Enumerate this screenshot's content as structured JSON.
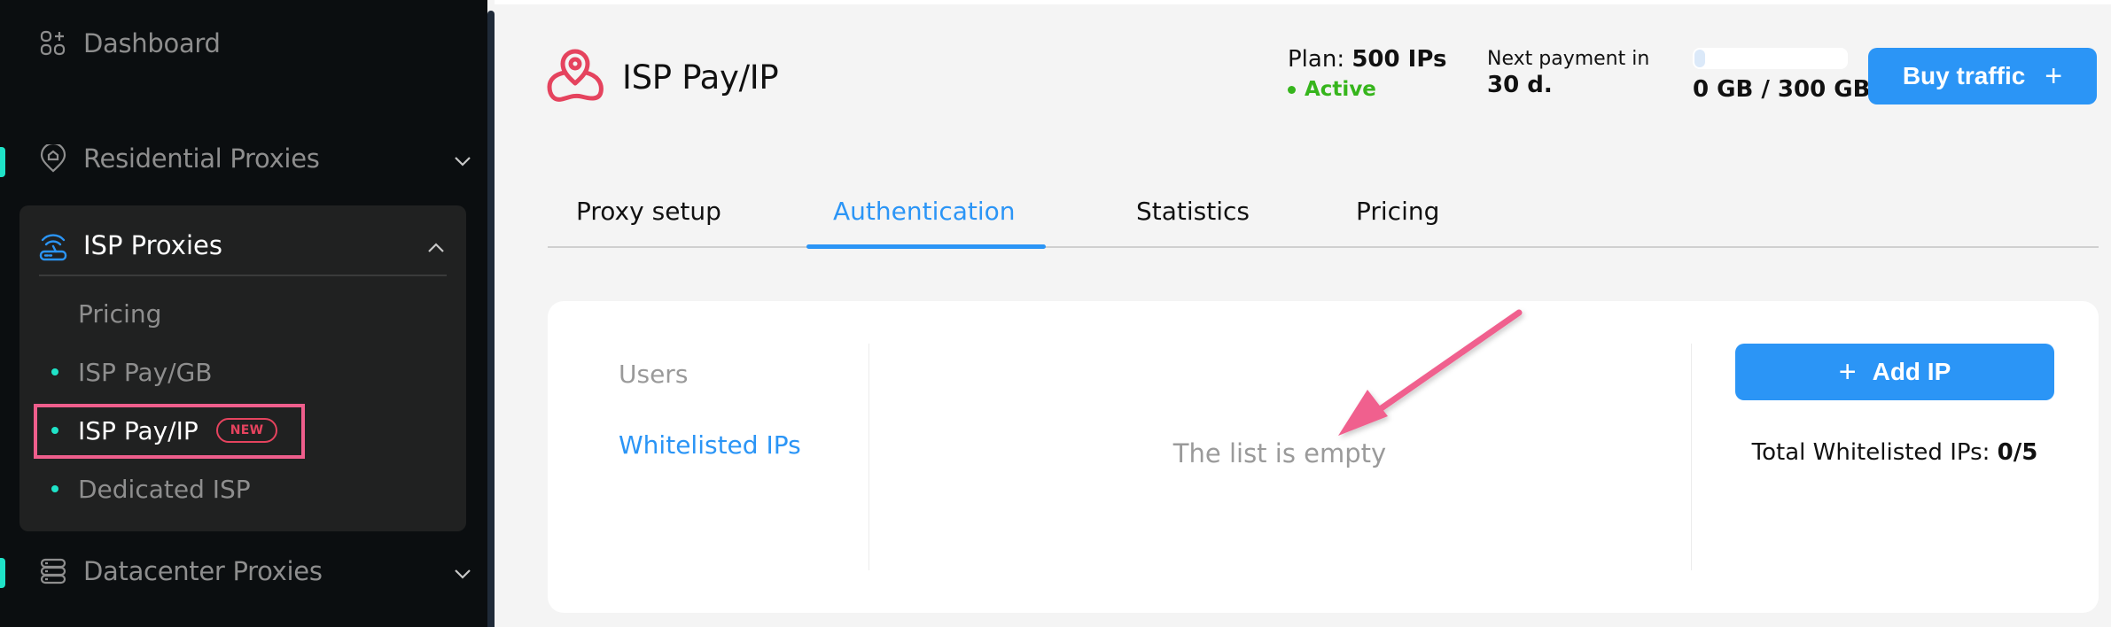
{
  "sidebar": {
    "items": [
      {
        "label": "Dashboard",
        "icon": "dashboard-grid-icon"
      },
      {
        "label": "Residential Proxies",
        "icon": "location-home-icon",
        "expanded": false
      },
      {
        "label": "ISP Proxies",
        "icon": "router-icon",
        "expanded": true,
        "children": [
          {
            "label": "Pricing"
          },
          {
            "label": "ISP Pay/GB"
          },
          {
            "label": "ISP Pay/IP",
            "badge": "NEW",
            "current": true
          },
          {
            "label": "Dedicated ISP"
          }
        ]
      },
      {
        "label": "Datacenter Proxies",
        "icon": "server-stack-icon",
        "expanded": false
      }
    ]
  },
  "header": {
    "product_title": "ISP Pay/IP",
    "plan_label": "Plan:",
    "plan_value": "500 IPs",
    "status": "Active",
    "next_payment_label": "Next payment in",
    "next_payment_value": "30 d.",
    "traffic_used_gb": 0,
    "traffic_total_gb": 300,
    "traffic_text": "0 GB / 300 GB",
    "buy_label": "Buy traffic",
    "buy_icon": "+"
  },
  "tabs": [
    {
      "label": "Proxy setup"
    },
    {
      "label": "Authentication",
      "active": true
    },
    {
      "label": "Statistics"
    },
    {
      "label": "Pricing"
    }
  ],
  "auth": {
    "nav": [
      {
        "label": "Users"
      },
      {
        "label": "Whitelisted IPs",
        "active": true
      }
    ],
    "empty_text": "The list is empty",
    "add_label": "Add IP",
    "add_icon": "+",
    "total_label": "Total Whitelisted IPs:",
    "total_value": "0/5"
  },
  "colors": {
    "accent": "#2b95f6",
    "active_status": "#36b51c",
    "sidebar_marker": "#1fe3c8",
    "new_badge": "#e5435e",
    "annotation": "#ef5e8c"
  }
}
